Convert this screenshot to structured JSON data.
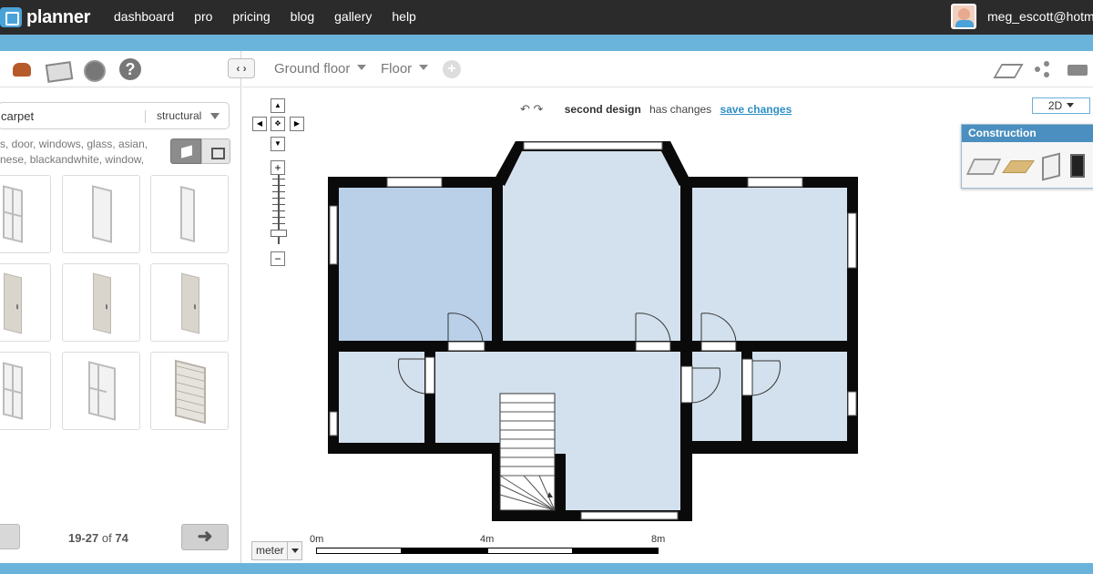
{
  "nav": {
    "logo_text": "planner",
    "links": [
      "dashboard",
      "pro",
      "pricing",
      "blog",
      "gallery",
      "help"
    ],
    "username": "meg_escott@hotm"
  },
  "sidebar": {
    "search_value": "carpet",
    "category": "structural",
    "tags_text": "s, door, windows, glass, asian, nese, blackandwhite, window,",
    "pager_range": "19-27",
    "pager_of": "of",
    "pager_total": "74",
    "next_arrow": "➜"
  },
  "toolbar": {
    "collapse": "‹ ›",
    "floor_name": "Ground floor",
    "floor_type": "Floor",
    "add": "+"
  },
  "canvas": {
    "undo": "↶ ↷",
    "design_name": "second design",
    "change_status": "has changes",
    "save_link": "save changes",
    "view_mode": "2D",
    "construction_title": "Construction",
    "unit": "meter",
    "scale_labels": [
      "0m",
      "4m",
      "8m"
    ]
  },
  "colors": {
    "nav_bg": "#2b2b2b",
    "accent_blue": "#6ab4dc",
    "link_blue": "#2e8fc4",
    "room_fill": "#d3e1ee",
    "room_selected": "#b9d0e8",
    "wall": "#0a0a0a"
  }
}
